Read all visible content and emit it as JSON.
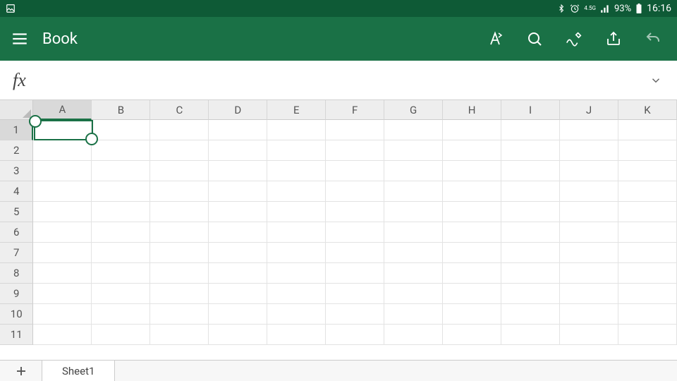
{
  "status": {
    "network_label": "4.5G",
    "battery_text": "93%",
    "time": "16:16"
  },
  "appbar": {
    "title": "Book"
  },
  "formula": {
    "fx_label": "fx",
    "value": ""
  },
  "sheet": {
    "columns": [
      "A",
      "B",
      "C",
      "D",
      "E",
      "F",
      "G",
      "H",
      "I",
      "J",
      "K"
    ],
    "rows": [
      "1",
      "2",
      "3",
      "4",
      "5",
      "6",
      "7",
      "8",
      "9",
      "10",
      "11"
    ],
    "selected_cell": "A1",
    "selected_col": "A",
    "selected_row": "1"
  },
  "tabs": {
    "active": "Sheet1",
    "sheets": [
      "Sheet1"
    ]
  }
}
